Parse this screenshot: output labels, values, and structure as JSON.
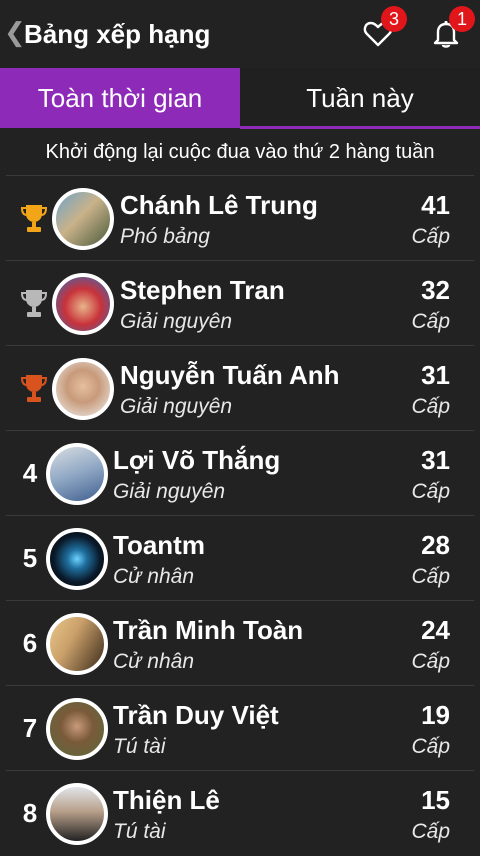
{
  "header": {
    "back_icon": "chevron-left-icon",
    "title": "Bảng xếp hạng",
    "favorites_count": "3",
    "notifications_count": "1"
  },
  "tabs": [
    {
      "label": "Toàn thời gian",
      "active": true
    },
    {
      "label": "Tuần này",
      "active": false
    }
  ],
  "subtitle": "Khởi động lại cuộc đua vào thứ 2 hàng tuần",
  "colors": {
    "accent": "#8e2ab8",
    "badge": "#e0161b",
    "gold": "#f2a516",
    "silver": "#b8b8b8",
    "bronze": "#d9531e"
  },
  "leaderboard": [
    {
      "rank": "",
      "trophy": "gold",
      "name": "Chánh Lê Trung",
      "title": "Phó bảng",
      "level": "41",
      "level_label": "Cấp"
    },
    {
      "rank": "",
      "trophy": "silver",
      "name": "Stephen Tran",
      "title": "Giải nguyên",
      "level": "32",
      "level_label": "Cấp"
    },
    {
      "rank": "",
      "trophy": "bronze",
      "name": "Nguyễn Tuấn Anh",
      "title": "Giải nguyên",
      "level": "31",
      "level_label": "Cấp"
    },
    {
      "rank": "4",
      "trophy": "",
      "name": "Lợi Võ Thắng",
      "title": "Giải nguyên",
      "level": "31",
      "level_label": "Cấp"
    },
    {
      "rank": "5",
      "trophy": "",
      "name": "Toantm",
      "title": "Cử nhân",
      "level": "28",
      "level_label": "Cấp"
    },
    {
      "rank": "6",
      "trophy": "",
      "name": "Trần Minh Toàn",
      "title": "Cử nhân",
      "level": "24",
      "level_label": "Cấp"
    },
    {
      "rank": "7",
      "trophy": "",
      "name": "Trần Duy Việt",
      "title": "Tú tài",
      "level": "19",
      "level_label": "Cấp"
    },
    {
      "rank": "8",
      "trophy": "",
      "name": "Thiện Lê",
      "title": "Tú tài",
      "level": "15",
      "level_label": "Cấp"
    }
  ]
}
